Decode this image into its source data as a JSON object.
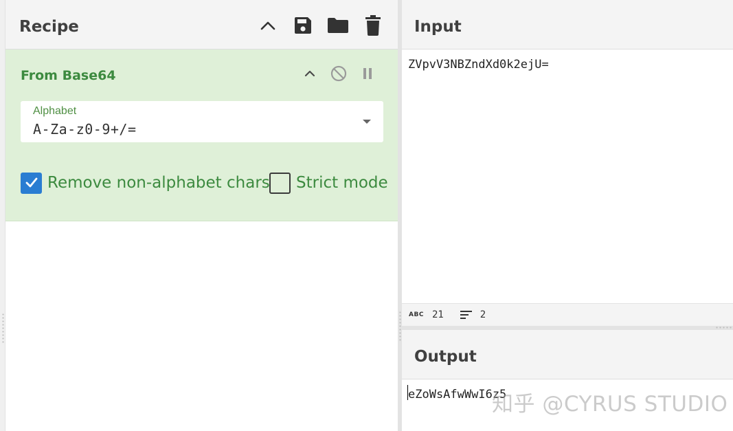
{
  "recipe": {
    "title": "Recipe",
    "toolbar": {
      "collapse": "chevron-up-icon",
      "save": "save-icon",
      "load": "folder-icon",
      "clear": "trash-icon"
    },
    "operation": {
      "name": "From Base64",
      "alphabet_label": "Alphabet",
      "alphabet_value": "A-Za-z0-9+/=",
      "remove_non_alphabet_label": "Remove non-alphabet chars",
      "remove_non_alphabet_checked": true,
      "strict_mode_label": "Strict mode",
      "strict_mode_checked": false
    }
  },
  "input": {
    "title": "Input",
    "text": "ZVpvV3NBZndXd0k2ejU=",
    "status": {
      "chars": "21",
      "lines": "2"
    }
  },
  "output": {
    "title": "Output",
    "text": "eZoWsAfwWwI6z5"
  },
  "watermark": "知乎 @CYRUS STUDIO",
  "colors": {
    "op_background": "#dff0d8",
    "op_text": "#3c8a3f",
    "checkbox_on": "#2a7dd2"
  }
}
